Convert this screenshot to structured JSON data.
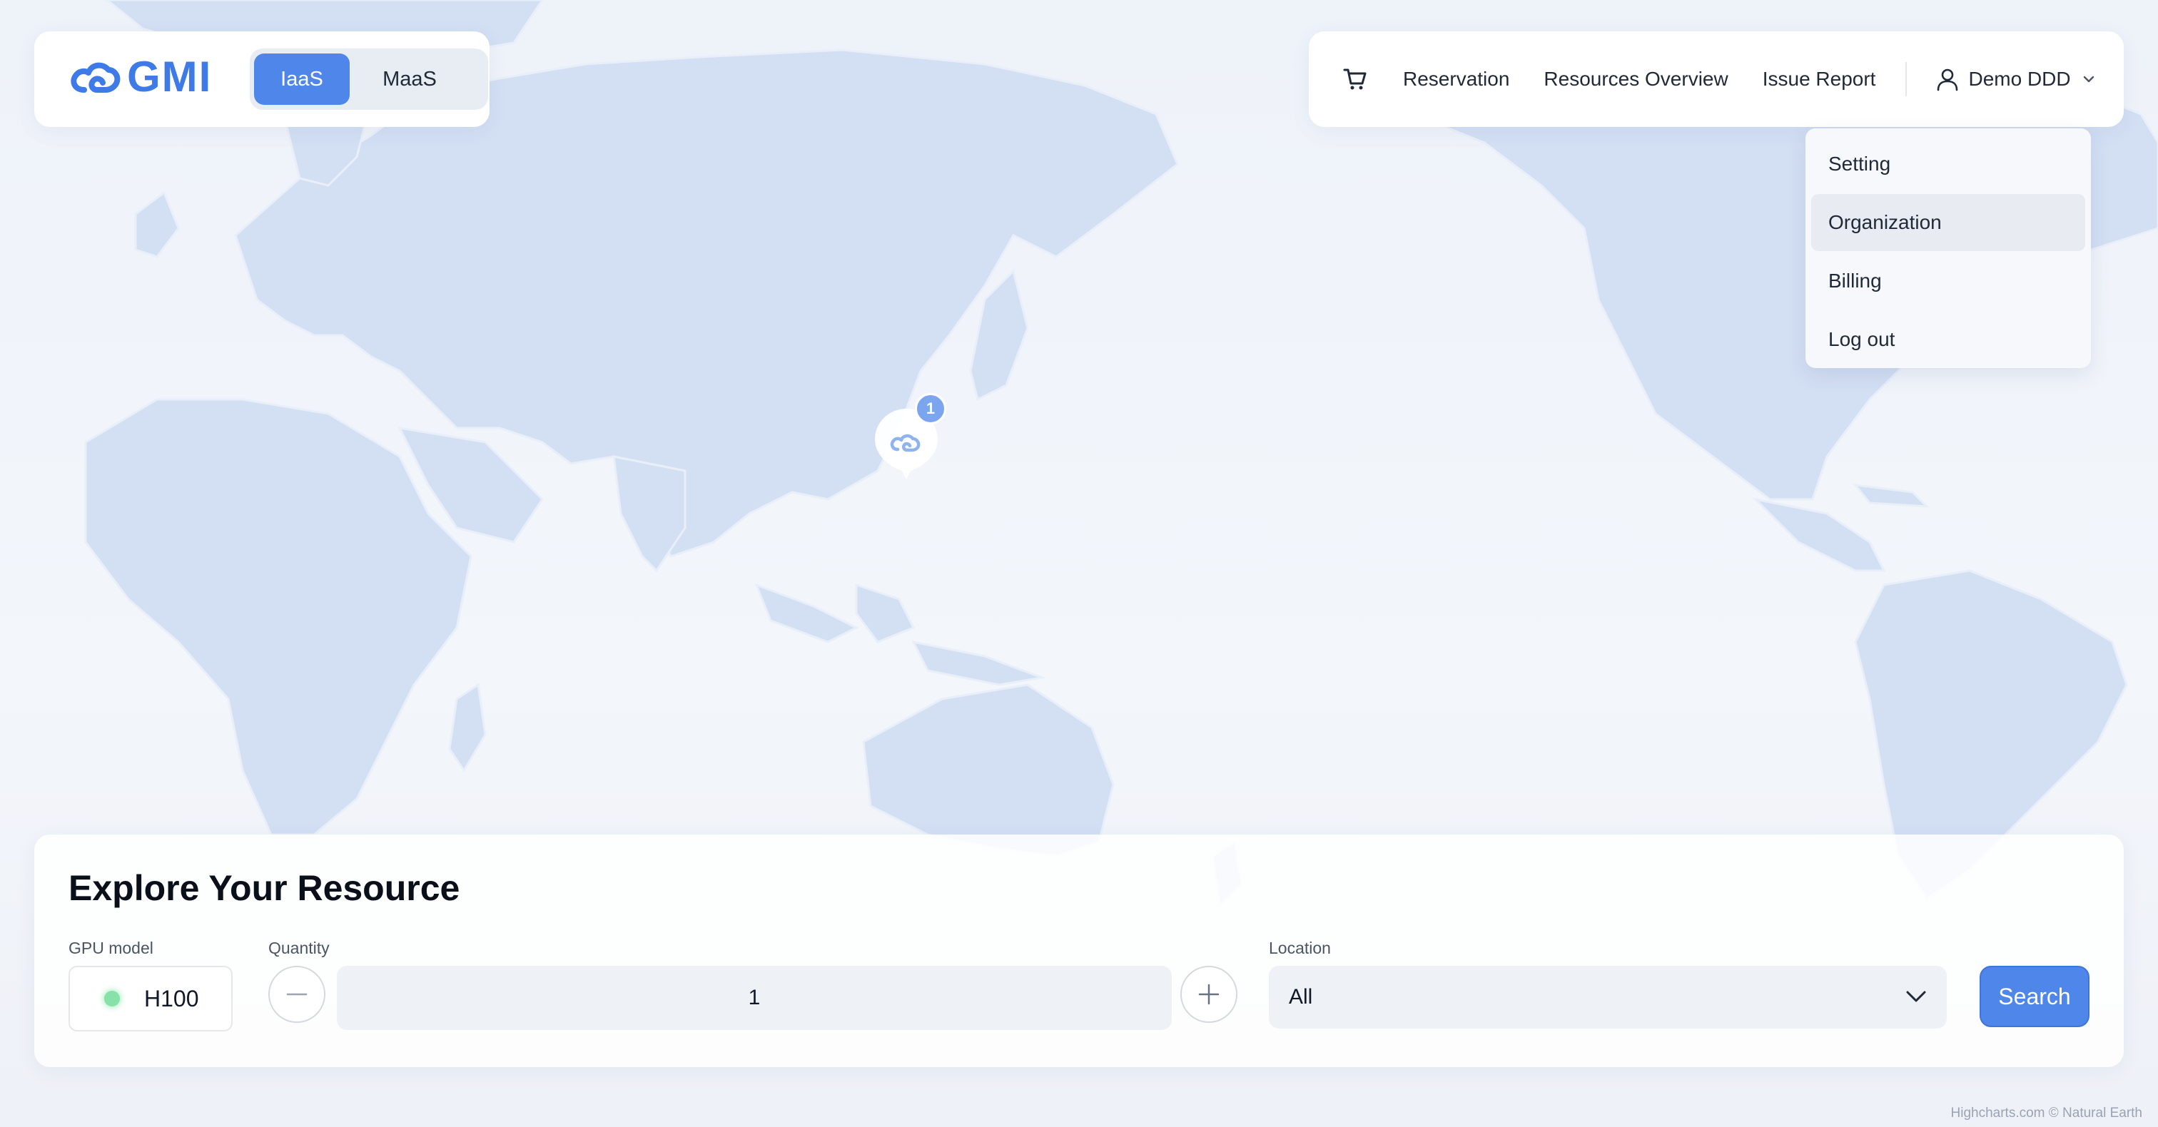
{
  "brand": {
    "logo_text": "GMI",
    "modes": [
      "IaaS",
      "MaaS"
    ],
    "active_mode": "IaaS"
  },
  "nav": {
    "items": [
      "Reservation",
      "Resources Overview",
      "Issue Report"
    ],
    "user_name": "Demo DDD"
  },
  "user_menu": {
    "items": [
      "Setting",
      "Organization",
      "Billing",
      "Log out"
    ],
    "hovered": "Organization"
  },
  "map": {
    "marker_count": "1",
    "credits": "Highcharts.com © Natural Earth"
  },
  "explore": {
    "title": "Explore Your Resource",
    "gpu_label": "GPU model",
    "gpu_value": "H100",
    "quantity_label": "Quantity",
    "quantity_value": "1",
    "location_label": "Location",
    "location_value": "All",
    "search_label": "Search"
  },
  "colors": {
    "accent": "#4f86ea",
    "land": "#d6e2f5",
    "status_available": "#86e2a8"
  }
}
